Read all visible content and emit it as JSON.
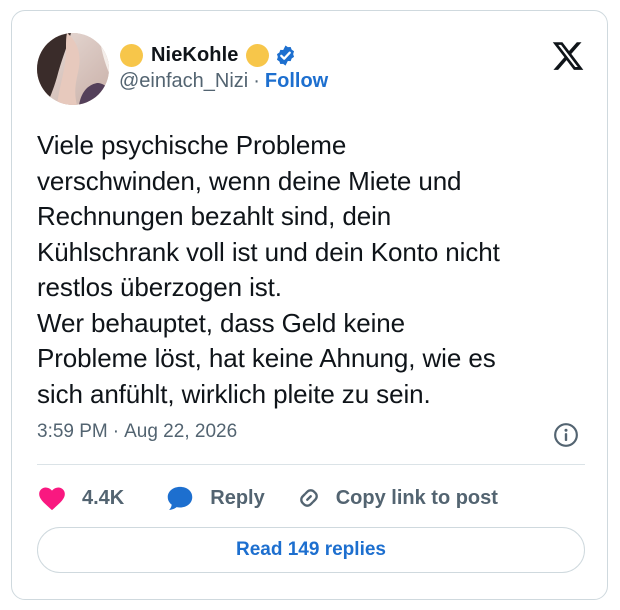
{
  "author": {
    "display_name": "NieKohle",
    "handle": "@einfach_Nizi",
    "separator": "·",
    "follow_label": "Follow",
    "name_emoji_color": "#f7c64a",
    "verified_color": "#1d6fcf"
  },
  "tweet": {
    "text": "Viele psychische Probleme\nverschwinden, wenn deine Miete und\nRechnungen bezahlt sind, dein\nKühlschrank voll ist und dein Konto nicht\nrestlos überzogen ist.\nWer behauptet, dass Geld keine\nProbleme löst, hat keine Ahnung, wie es\nsich anfühlt, wirklich pleite zu sein.",
    "time": "3:59 PM",
    "separator": "·",
    "date": "Aug 22, 2026"
  },
  "actions": {
    "like_count": "4.4K",
    "reply_label": "Reply",
    "copy_label": "Copy link to post",
    "like_color": "#f91880",
    "reply_color": "#1d6fcf"
  },
  "read_replies_label": "Read 149 replies",
  "icons": [
    "x-logo-icon",
    "verified-badge-icon",
    "info-icon",
    "heart-icon",
    "reply-bubble-icon",
    "link-icon"
  ]
}
